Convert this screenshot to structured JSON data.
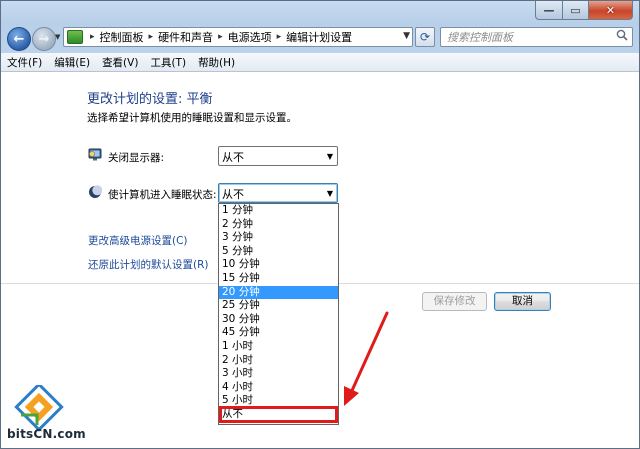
{
  "window": {
    "caption_buttons": {
      "minimize": "—",
      "maximize": "▭",
      "close": "✕"
    }
  },
  "navigation": {
    "back_icon": "back-arrow-icon",
    "forward_icon": "forward-arrow-icon",
    "breadcrumbs": [
      "控制面板",
      "硬件和声音",
      "电源选项",
      "编辑计划设置"
    ],
    "search_placeholder": "搜索控制面板"
  },
  "menu": {
    "items": [
      "文件(F)",
      "编辑(E)",
      "查看(V)",
      "工具(T)",
      "帮助(H)"
    ]
  },
  "main": {
    "title": "更改计划的设置: 平衡",
    "subtitle": "选择希望计算机使用的睡眠设置和显示设置。",
    "settings": [
      {
        "label": "关闭显示器:",
        "value": "从不",
        "icon": "monitor-icon"
      },
      {
        "label": "使计算机进入睡眠状态:",
        "value": "从不",
        "icon": "moon-sleep-icon"
      }
    ],
    "links": [
      "更改高级电源设置(C)",
      "还原此计划的默认设置(R)"
    ],
    "buttons": {
      "save": "保存修改",
      "cancel": "取消"
    }
  },
  "dropdown": {
    "options": [
      "1 分钟",
      "2 分钟",
      "3 分钟",
      "5 分钟",
      "10 分钟",
      "15 分钟",
      "20 分钟",
      "25 分钟",
      "30 分钟",
      "45 分钟",
      "1 小时",
      "2 小时",
      "3 小时",
      "4 小时",
      "5 小时",
      "从不"
    ],
    "highlighted": "20 分钟"
  },
  "annotation": {
    "color": "#e11a1a",
    "marked_option": "从不"
  },
  "watermark": {
    "text": "bitsCN.com"
  }
}
